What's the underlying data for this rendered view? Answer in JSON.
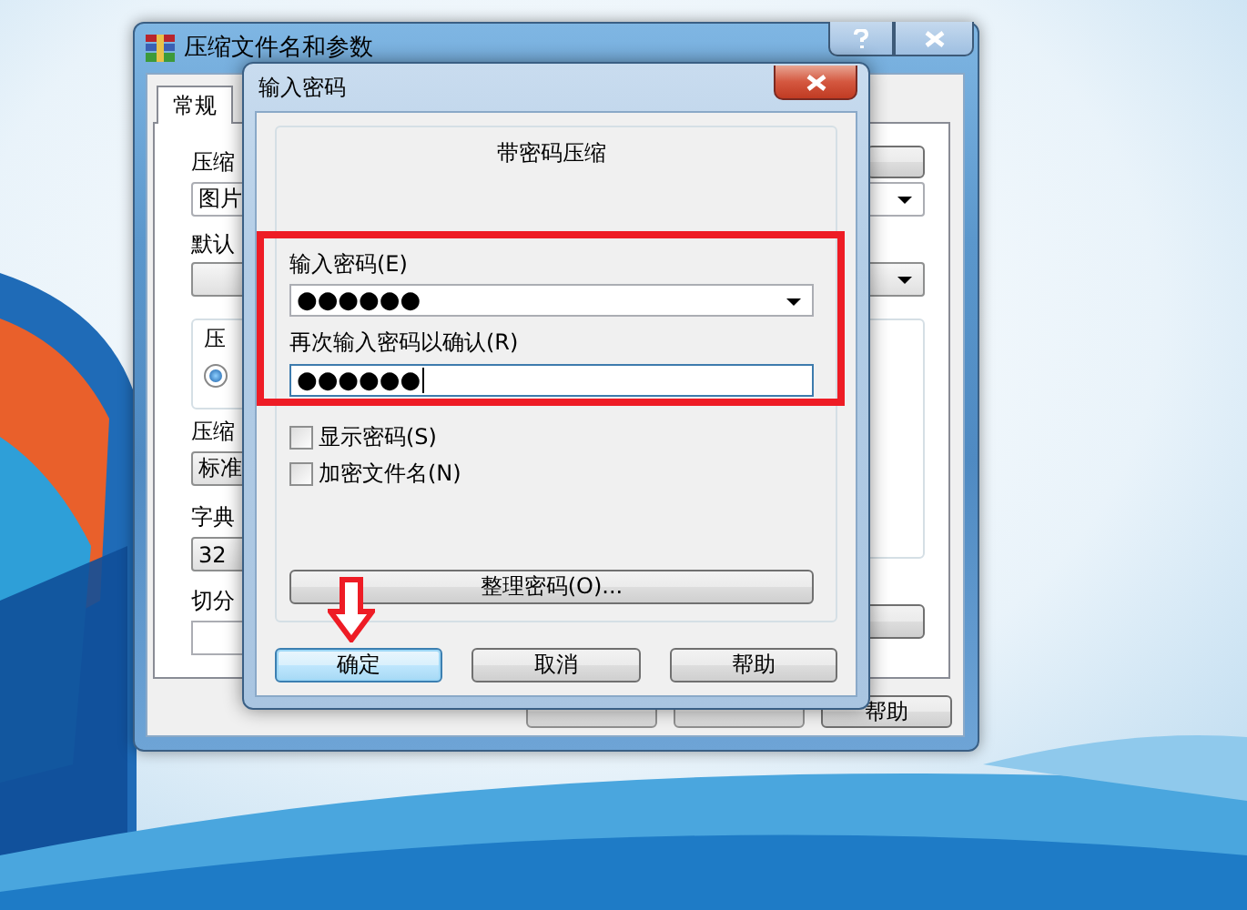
{
  "back_window": {
    "title": "压缩文件名和参数",
    "tabs": [
      {
        "label": "常规",
        "selected": true
      }
    ],
    "labels": [
      "压缩",
      "默认",
      "压缩",
      "字典",
      "切分"
    ],
    "archive_field": "图片",
    "group_label": "压",
    "radio": {
      "checked": true
    },
    "method_field": "标准",
    "dictionary_field": "32",
    "buttons": [
      {
        "covered": true
      },
      {
        "covered": true
      },
      {
        "label": "帮助",
        "covered": false
      }
    ]
  },
  "dialog": {
    "title": "输入密码",
    "heading": "带密码压缩",
    "password": {
      "label": "输入密码(E)",
      "value": "●●●●●●"
    },
    "confirm": {
      "label": "再次输入密码以确认(R)",
      "value": "●●●●●●",
      "focused": true
    },
    "checkboxes": [
      {
        "label": "显示密码(S)",
        "checked": false
      },
      {
        "label": "加密文件名(N)",
        "checked": false
      }
    ],
    "organize_button": "整理密码(O)...",
    "buttons": [
      {
        "label": "确定",
        "default": true
      },
      {
        "label": "取消",
        "default": false
      },
      {
        "label": "帮助",
        "default": false
      }
    ]
  },
  "annotations": {
    "highlight_box": true,
    "pointer_arrow": true
  }
}
